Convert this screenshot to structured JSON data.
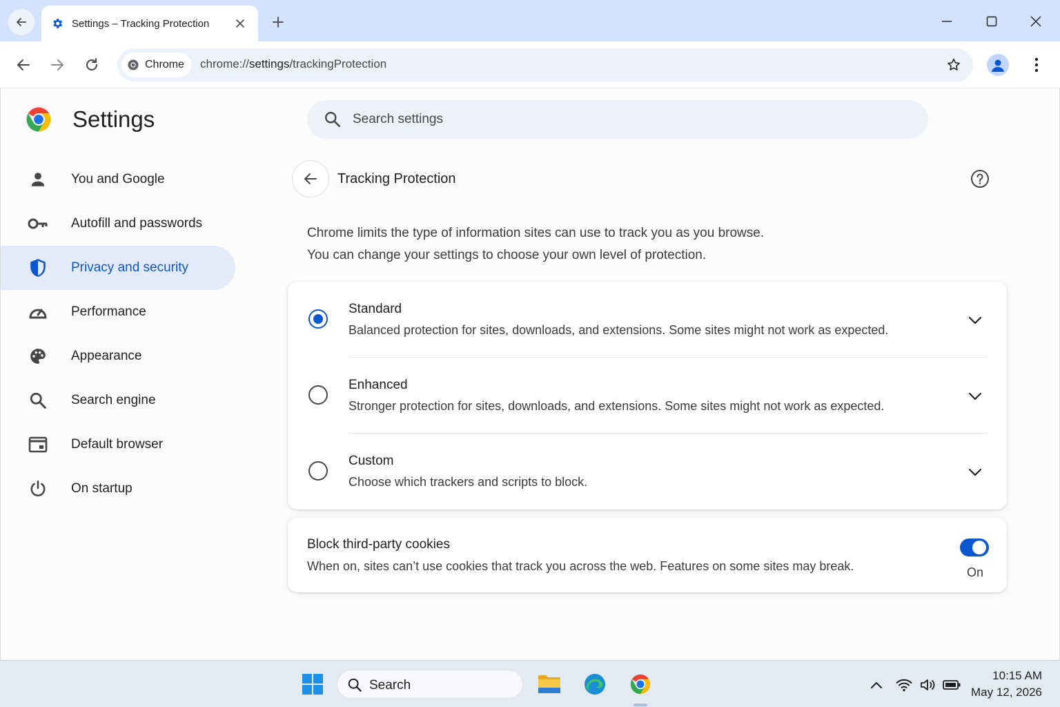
{
  "browser": {
    "tab_title": "Settings – Tracking Protection",
    "site_chip": "Chrome",
    "url_prefix": "chrome://",
    "url_host": "settings",
    "url_path": "/trackingProtection"
  },
  "settings": {
    "brand_title": "Settings",
    "search_placeholder": "Search settings",
    "sidebar": [
      {
        "label": "You and Google",
        "icon": "person-icon"
      },
      {
        "label": "Autofill and passwords",
        "icon": "key-icon"
      },
      {
        "label": "Privacy and security",
        "icon": "shield-icon",
        "active": true
      },
      {
        "label": "Performance",
        "icon": "speedometer-icon"
      },
      {
        "label": "Appearance",
        "icon": "palette-icon"
      },
      {
        "label": "Search engine",
        "icon": "search-icon"
      },
      {
        "label": "Default browser",
        "icon": "browser-window-icon"
      },
      {
        "label": "On startup",
        "icon": "power-icon"
      }
    ],
    "page_title": "Tracking Protection",
    "intro_line1": "Chrome limits the type of information sites can use to track you as you browse.",
    "intro_line2": "You can change your settings to choose your own level of protection.",
    "options": [
      {
        "title": "Standard",
        "desc": "Balanced protection for sites, downloads, and extensions. Some sites might not work as expected.",
        "selected": true
      },
      {
        "title": "Enhanced",
        "desc": "Stronger protection for sites, downloads, and extensions. Some sites might not work as expected.",
        "selected": false
      },
      {
        "title": "Custom",
        "desc": "Choose which trackers and scripts to block.",
        "selected": false
      }
    ],
    "cookies": {
      "title": "Block third-party cookies",
      "desc": "When on, sites can’t use cookies that track you across the web. Features on some sites may break.",
      "toggle_label": "On",
      "enabled": true
    }
  },
  "taskbar": {
    "search_label": "Search",
    "time": "10:15 AM",
    "date": "May 12, 2026"
  },
  "colors": {
    "accent": "#0b57d0",
    "active_nav_bg": "#e3ebfb",
    "tabstrip_bg": "#d3e3fd"
  }
}
